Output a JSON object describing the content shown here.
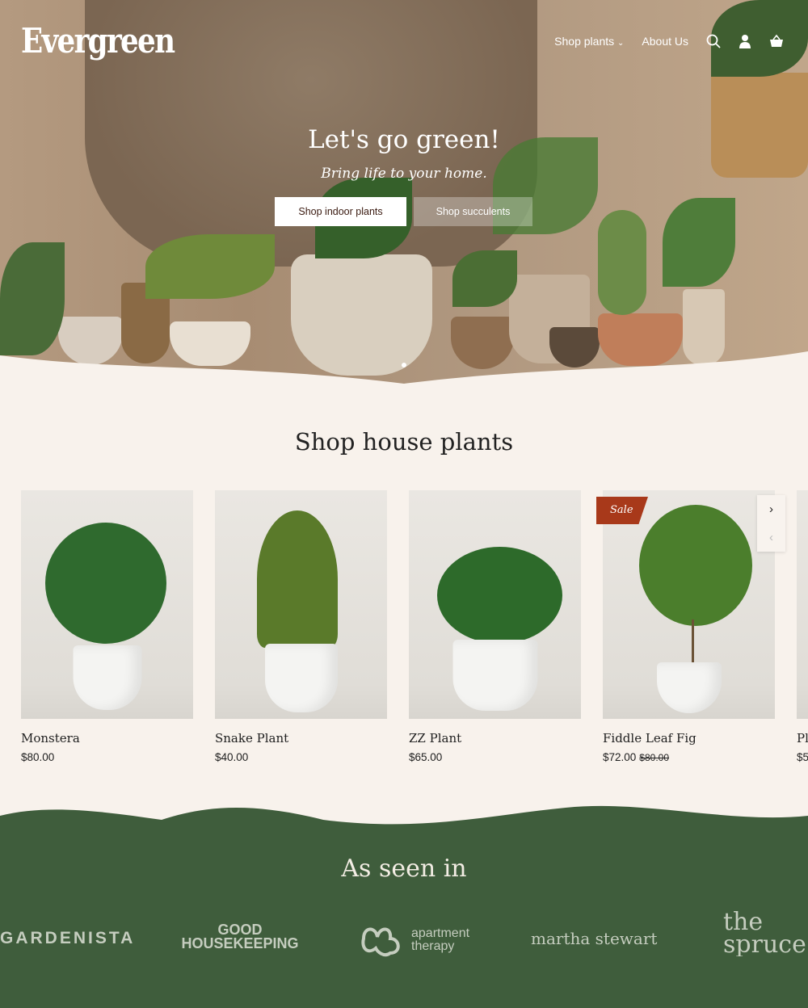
{
  "nav": {
    "logo": "Evergreen",
    "links": [
      {
        "label": "Shop plants"
      },
      {
        "label": "About Us"
      }
    ],
    "icons": [
      "search-icon",
      "account-icon",
      "cart-icon"
    ]
  },
  "hero": {
    "title": "Let's go green!",
    "subtitle": "Bring life to your home.",
    "buttons": [
      {
        "label": "Shop indoor plants"
      },
      {
        "label": "Shop succulents"
      }
    ],
    "slide": 1
  },
  "products": {
    "title": "Shop house plants",
    "items": [
      {
        "name": "Monstera",
        "price": "$80.00"
      },
      {
        "name": "Snake Plant",
        "price": "$40.00"
      },
      {
        "name": "ZZ Plant",
        "price": "$65.00"
      },
      {
        "name": "Fiddle Leaf Fig",
        "price": "$72.00",
        "compare_price": "$80.00",
        "badge": "Sale"
      },
      {
        "name": "Pl",
        "price": "$5"
      }
    ]
  },
  "press": {
    "title": "As seen in",
    "logos": [
      "GARDENISTA",
      "GOOD HOUSEKEEPING",
      "apartment therapy",
      "martha stewart",
      "the spruce"
    ]
  },
  "colors": {
    "green": "#3f5d3c",
    "cream": "#f8f2ec",
    "sale": "#a8391a"
  }
}
